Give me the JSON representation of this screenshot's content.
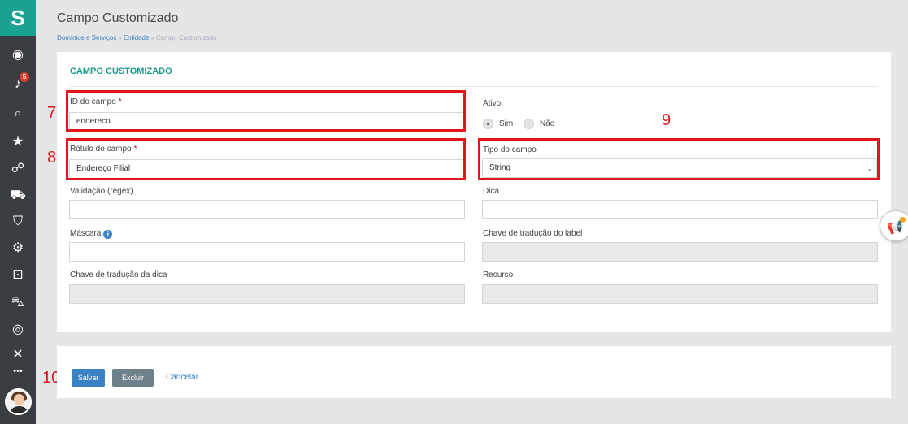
{
  "sidebar": {
    "logo": "S",
    "notification_badge": "5",
    "items": [
      {
        "icon": "user-circle-icon",
        "glyph": "◉"
      },
      {
        "icon": "bell-icon",
        "glyph": "♪"
      },
      {
        "icon": "search-icon",
        "glyph": "⌕"
      },
      {
        "icon": "star-icon",
        "glyph": "★"
      },
      {
        "icon": "sitemap-icon",
        "glyph": "☍"
      },
      {
        "icon": "forklift-icon",
        "glyph": "⛟"
      },
      {
        "icon": "shield-icon",
        "glyph": "⛉"
      },
      {
        "icon": "users-cog-icon",
        "glyph": "⚙"
      },
      {
        "icon": "lock-icon",
        "glyph": "⊡"
      },
      {
        "icon": "truck-icon",
        "glyph": "⛍"
      },
      {
        "icon": "target-icon",
        "glyph": "◎"
      },
      {
        "icon": "close-x-icon",
        "glyph": "✕"
      },
      {
        "icon": "more-icon",
        "glyph": "•••"
      }
    ]
  },
  "header": {
    "title": "Campo Customizado",
    "breadcrumb": [
      {
        "label": "Domínios e Serviços"
      },
      {
        "label": "Entidade"
      },
      {
        "label": "Campo Customizado"
      }
    ],
    "separator": "»"
  },
  "form": {
    "section_title": "CAMPO CUSTOMIZADO",
    "id_label": "ID do campo",
    "id_value": "endereco",
    "required_mark": "*",
    "ativo_label": "Ativo",
    "ativo_sim": "Sim",
    "ativo_nao": "Não",
    "rotulo_label": "Rótulo do campo",
    "rotulo_value": "Endereço Filial",
    "tipo_label": "Tipo do campo",
    "tipo_value": "String",
    "validacao_label": "Validação (regex)",
    "validacao_value": "",
    "dica_label": "Dica",
    "dica_value": "",
    "mascara_label": "Máscara",
    "mascara_value": "",
    "chave_label_label": "Chave de tradução do label",
    "chave_label_value": "",
    "chave_dica_label": "Chave de tradução da dica",
    "chave_dica_value": "",
    "recurso_label": "Recurso",
    "recurso_value": ""
  },
  "actions": {
    "save": "Salvar",
    "delete": "Excluir",
    "cancel": "Cancelar"
  },
  "annotations": {
    "n7": "7",
    "n8": "8",
    "n9": "9",
    "n10": "10"
  },
  "colors": {
    "sidebar_bg": "#3a3d42",
    "logo_bg": "#1aa392",
    "section_title": "#1a9a8a",
    "primary": "#3b82c4",
    "annotation_red": "#e0161b"
  }
}
